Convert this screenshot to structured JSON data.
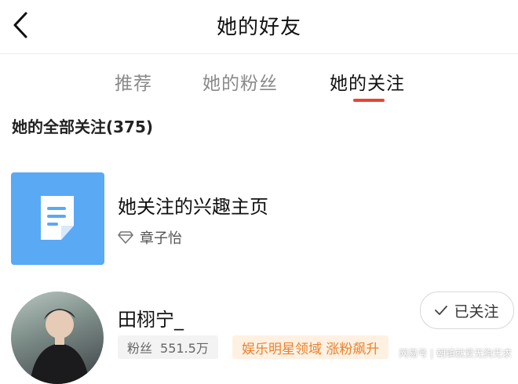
{
  "header": {
    "title": "她的好友"
  },
  "tabs": [
    {
      "label": "推荐"
    },
    {
      "label": "她的粉丝"
    },
    {
      "label": "她的关注",
      "active": true
    }
  ],
  "section": {
    "title": "她的全部关注(375)"
  },
  "interest": {
    "title": "她关注的兴趣主页",
    "owner": "章子怡",
    "icon": "document-icon"
  },
  "user": {
    "name": "田栩宁_",
    "fans_label": "粉丝",
    "fans_count": "551.5万",
    "tag": "娱乐明星领域 涨粉飙升",
    "follow_label": "已关注"
  },
  "watermark": "网易号 | 朝镇就爱无狗无求",
  "colors": {
    "accent": "#e8452f",
    "tile": "#5aa9f4",
    "tag": "#e8812f"
  }
}
